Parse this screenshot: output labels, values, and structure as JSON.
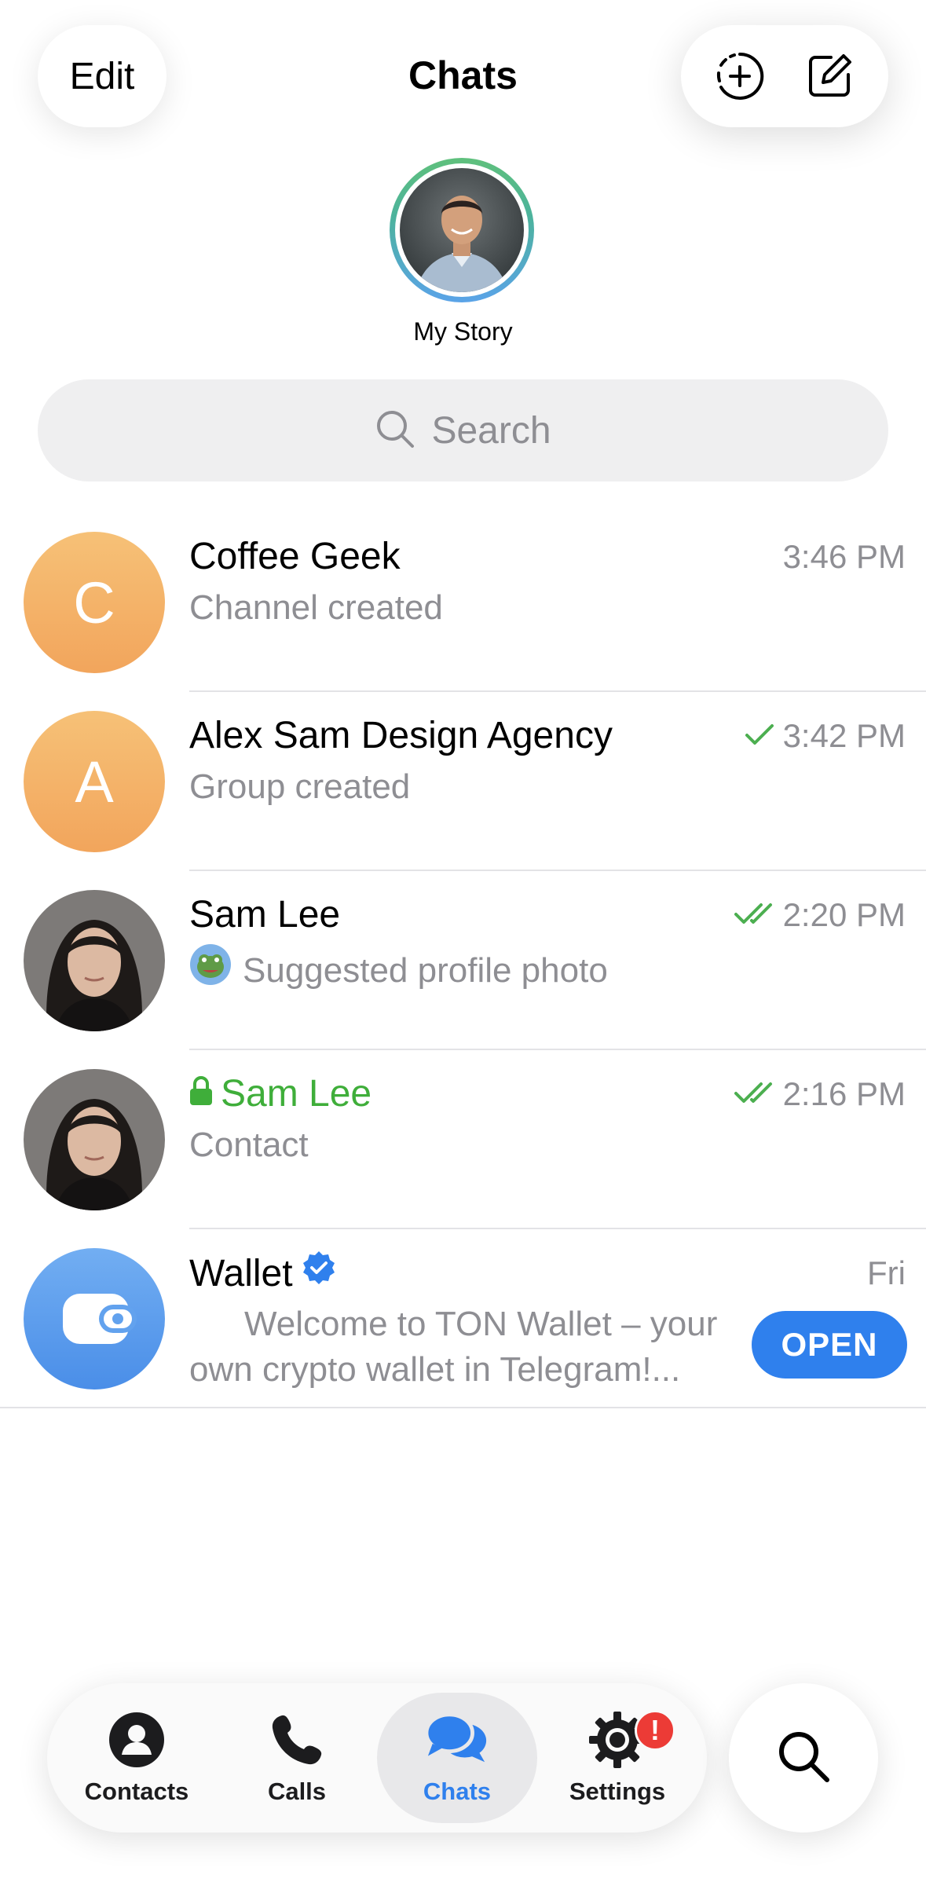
{
  "header": {
    "edit_label": "Edit",
    "title": "Chats",
    "new_story_icon": "add-story-icon",
    "compose_icon": "compose-icon"
  },
  "story": {
    "label": "My Story"
  },
  "search": {
    "placeholder": "Search"
  },
  "chats": [
    {
      "name": "Coffee Geek",
      "preview": "Channel created",
      "time": "3:46 PM",
      "avatar_letter": "C",
      "status": "none"
    },
    {
      "name": "Alex Sam Design Agency",
      "preview": "Group created",
      "time": "3:42 PM",
      "avatar_letter": "A",
      "status": "sent"
    },
    {
      "name": "Sam Lee",
      "preview": "Suggested profile photo",
      "time": "2:20 PM",
      "status": "read"
    },
    {
      "name": "Sam Lee",
      "preview": "Contact",
      "time": "2:16 PM",
      "status": "read",
      "secret": true
    },
    {
      "name": "Wallet",
      "preview": "Welcome to TON Wallet – your own crypto wallet in Telegram!...",
      "time": "Fri",
      "verified": true,
      "button": "OPEN"
    }
  ],
  "tabs": [
    {
      "label": "Contacts",
      "icon": "person-icon"
    },
    {
      "label": "Calls",
      "icon": "phone-icon"
    },
    {
      "label": "Chats",
      "icon": "chat-bubbles-icon",
      "active": true
    },
    {
      "label": "Settings",
      "icon": "gear-icon",
      "badge": "!"
    }
  ],
  "colors": {
    "accent": "#2f80ed",
    "secret_green": "#3fae3a",
    "check_green": "#4caf50",
    "badge_red": "#ec3b36",
    "secondary_text": "#8e8e93"
  }
}
